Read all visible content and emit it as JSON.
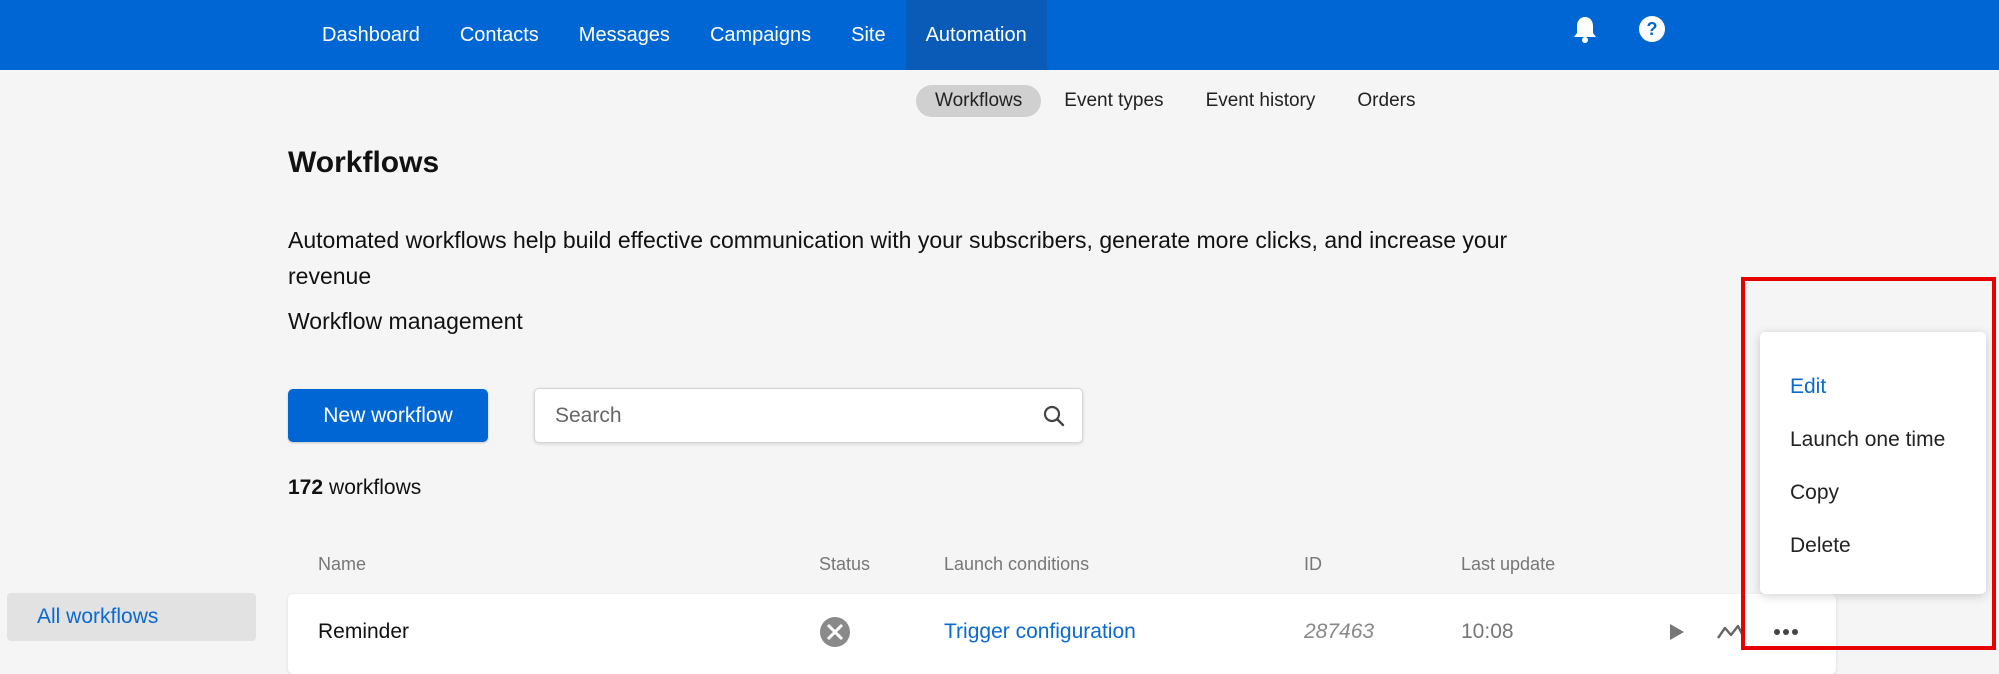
{
  "top_nav": {
    "items": [
      {
        "label": "Dashboard"
      },
      {
        "label": "Contacts"
      },
      {
        "label": "Messages"
      },
      {
        "label": "Campaigns"
      },
      {
        "label": "Site"
      },
      {
        "label": "Automation",
        "active": true
      }
    ],
    "icons": [
      "bell-icon",
      "help-icon"
    ]
  },
  "sub_nav": {
    "items": [
      {
        "label": "Workflows",
        "active": true
      },
      {
        "label": "Event types"
      },
      {
        "label": "Event history"
      },
      {
        "label": "Orders"
      }
    ]
  },
  "page": {
    "title": "Workflows",
    "description": "Automated workflows help build effective communication with your subscribers, generate more clicks, and increase your revenue",
    "management_title": "Workflow management",
    "new_button": "New workflow",
    "search_placeholder": "Search",
    "count_number": "172",
    "count_label": "workflows"
  },
  "sidebar": {
    "items": [
      {
        "label": "All workflows",
        "active": true
      }
    ]
  },
  "table": {
    "columns": [
      "Name",
      "Status",
      "Launch conditions",
      "ID",
      "Last update"
    ],
    "rows": [
      {
        "name": "Reminder",
        "status_icon": "workflow-status-icon",
        "launch_conditions": "Trigger configuration",
        "id": "287463",
        "last_update": "10:08"
      }
    ],
    "row_action_icons": [
      "play-icon",
      "stats-icon",
      "more-icon"
    ]
  },
  "context_menu": {
    "items": [
      {
        "label": "Edit",
        "active": true
      },
      {
        "label": "Launch one time"
      },
      {
        "label": "Copy"
      },
      {
        "label": "Delete"
      }
    ]
  },
  "colors": {
    "brand": "#0066d4",
    "link": "#0a6ad0",
    "highlight": "#e60000"
  }
}
